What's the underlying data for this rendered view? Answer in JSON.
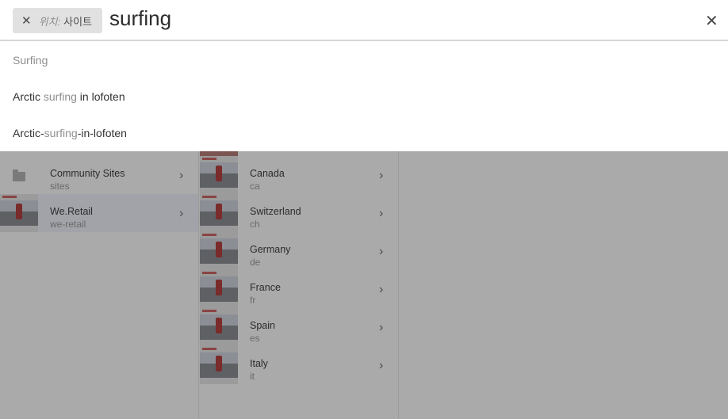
{
  "search": {
    "scope_prefix": "위치:",
    "scope_label": "사이트",
    "query": "surfing",
    "close_glyph": "✕"
  },
  "suggestions": [
    {
      "before": "",
      "match": "Surfing",
      "after": ""
    },
    {
      "before": "Arctic ",
      "match": "surfing",
      "after": " in lofoten"
    },
    {
      "before": "Arctic-",
      "match": "surfing",
      "after": "-in-lofoten"
    }
  ],
  "column1": [
    {
      "title": "Community Sites",
      "sub": "sites",
      "icon": "folder-icon"
    },
    {
      "title": "We.Retail",
      "sub": "we-retail",
      "icon": "thumbnail"
    }
  ],
  "column2": [
    {
      "title": "Canada",
      "sub": "ca"
    },
    {
      "title": "Switzerland",
      "sub": "ch"
    },
    {
      "title": "Germany",
      "sub": "de"
    },
    {
      "title": "France",
      "sub": "fr"
    },
    {
      "title": "Spain",
      "sub": "es"
    },
    {
      "title": "Italy",
      "sub": "it"
    }
  ],
  "glyphs": {
    "chevron": "›"
  }
}
